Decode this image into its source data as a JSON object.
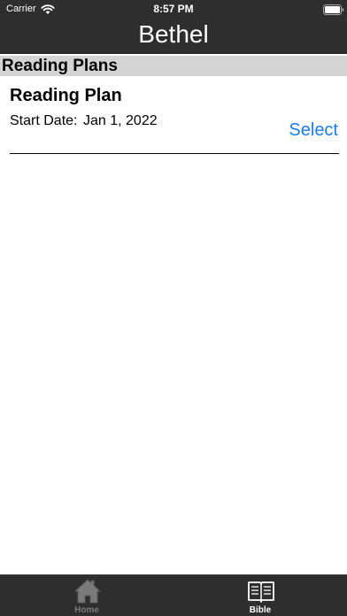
{
  "status_bar": {
    "carrier": "Carrier",
    "time": "8:57 PM"
  },
  "header": {
    "title": "Bethel"
  },
  "section": {
    "title": "Reading Plans"
  },
  "plans": [
    {
      "name": "Reading Plan",
      "start_label": "Start Date:",
      "start_value": "Jan 1, 2022",
      "action_label": "Select"
    }
  ],
  "tabbar": {
    "tabs": [
      {
        "label": "Home",
        "icon": "home-icon",
        "selected": false
      },
      {
        "label": "Bible",
        "icon": "book-icon",
        "selected": true
      }
    ]
  },
  "colors": {
    "bar_background": "#2e2e2e",
    "section_background": "#d4d4d4",
    "accent": "#1a7cf0",
    "tab_inactive": "#7a7a7a",
    "tab_active": "#ffffff"
  }
}
